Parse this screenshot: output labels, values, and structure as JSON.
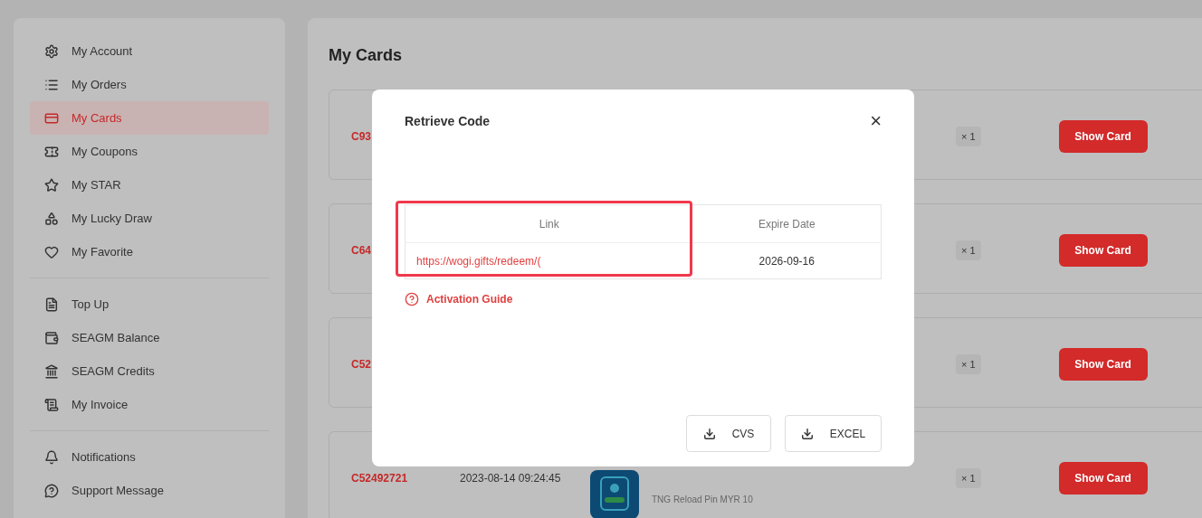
{
  "sidebar": {
    "groups": [
      {
        "items": [
          {
            "label": "My Account",
            "selected": false
          },
          {
            "label": "My Orders",
            "selected": false
          },
          {
            "label": "My Cards",
            "selected": true
          },
          {
            "label": "My Coupons",
            "selected": false
          },
          {
            "label": "My STAR",
            "selected": false
          },
          {
            "label": "My Lucky Draw",
            "selected": false
          },
          {
            "label": "My Favorite",
            "selected": false
          }
        ]
      },
      {
        "items": [
          {
            "label": "Top Up",
            "selected": false
          },
          {
            "label": "SEAGM Balance",
            "selected": false
          },
          {
            "label": "SEAGM Credits",
            "selected": false
          },
          {
            "label": "My Invoice",
            "selected": false
          }
        ]
      },
      {
        "items": [
          {
            "label": "Notifications",
            "selected": false
          },
          {
            "label": "Support Message",
            "selected": false
          }
        ]
      }
    ]
  },
  "main": {
    "title": "My Cards",
    "cards": [
      {
        "order_id": "C93",
        "quantity": "× 1",
        "button": "Show Card"
      },
      {
        "order_id": "C64",
        "quantity": "× 1",
        "button": "Show Card"
      },
      {
        "order_id": "C52",
        "quantity": "× 1",
        "button": "Show Card"
      },
      {
        "order_id": "C52492721",
        "date": "2023-08-14 09:24:45",
        "product": {
          "kind": "picture",
          "subtitle": "TNG Reload Pin MYR 10"
        },
        "quantity": "× 1",
        "button": "Show Card"
      }
    ]
  },
  "modal": {
    "title": "Retrieve Code",
    "close": "×",
    "table": {
      "columns": [
        {
          "label": "Link",
          "highlighted": true
        },
        {
          "label": "Expire Date",
          "highlighted": false
        }
      ],
      "rows": [
        [
          "https://wogi.gifts/redeem/(",
          "2026-09-16"
        ]
      ]
    },
    "guide_link": "Activation Guide",
    "buttons": [
      "CVS",
      "EXCEL"
    ]
  }
}
